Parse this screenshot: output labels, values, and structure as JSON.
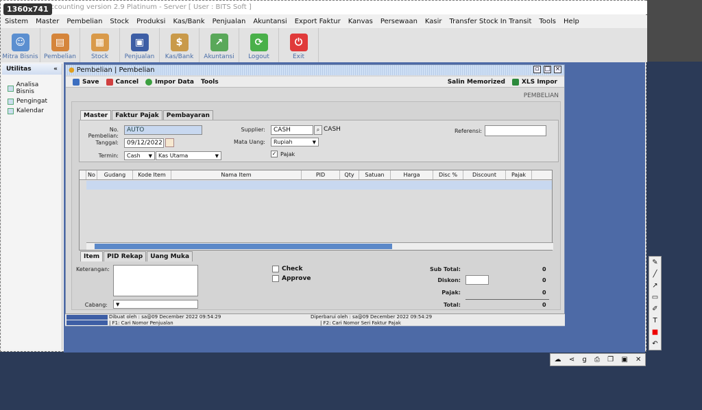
{
  "size_badge": "1360x741",
  "app_title": "Accounting version 2.9 Platinum - Server  [ User : BITS Soft ]",
  "menu": [
    "Sistem",
    "Master",
    "Pembelian",
    "Stock",
    "Produksi",
    "Kas/Bank",
    "Penjualan",
    "Akuntansi",
    "Export Faktur",
    "Kanvas",
    "Persewaan",
    "Kasir",
    "Transfer Stock In Transit",
    "Tools",
    "Help"
  ],
  "toolbar": [
    {
      "label": "Mitra Bisnis",
      "icon": "users-icon",
      "color": "#5b8fd0"
    },
    {
      "label": "Pembelian",
      "icon": "notebook-icon",
      "color": "#d5853b"
    },
    {
      "label": "Stock",
      "icon": "boxes-icon",
      "color": "#d99a4a"
    },
    {
      "label": "Penjualan",
      "icon": "shopping-bag-icon",
      "color": "#3d5ea5"
    },
    {
      "label": "Kas/Bank",
      "icon": "money-bag-icon",
      "color": "#c99a4a"
    },
    {
      "label": "Akuntansi",
      "icon": "chart-up-icon",
      "color": "#5aa85a"
    },
    {
      "label": "Logout",
      "icon": "logout-arrow-icon",
      "color": "#4ab04a"
    },
    {
      "label": "Exit",
      "icon": "power-icon",
      "color": "#e03a3a"
    }
  ],
  "sidebar": {
    "title": "Utilitas",
    "items": [
      "Analisa Bisnis",
      "Pengingat",
      "Kalendar"
    ]
  },
  "window": {
    "title": "Pembelian | Pembelian",
    "save": "Save",
    "cancel": "Cancel",
    "impor": "Impor Data",
    "tools": "Tools",
    "salin": "Salin Memorized",
    "xls": "XLS Impor",
    "section_label": "PEMBELIAN"
  },
  "form": {
    "tabs": [
      "Master",
      "Faktur Pajak",
      "Pembayaran"
    ],
    "no_label": "No. Pembelian:",
    "no_value": "AUTO",
    "tanggal_label": "Tanggal:",
    "tanggal_value": "09/12/2022",
    "termin_label": "Termin:",
    "termin_value": "Cash",
    "kas_value": "Kas Utama",
    "supplier_label": "Supplier:",
    "supplier_value": "CASH",
    "supplier_name": "CASH",
    "mata_uang_label": "Mata Uang:",
    "mata_uang_value": "Rupiah",
    "pajak_label": "Pajak",
    "referensi_label": "Referensi:"
  },
  "grid": {
    "columns": [
      "No",
      "Gudang",
      "Kode Item",
      "Nama Item",
      "PID",
      "Qty",
      "Satuan",
      "Harga",
      "Disc %",
      "Discount",
      "Pajak"
    ]
  },
  "bottom_tabs": [
    "Item",
    "PID Rekap",
    "Uang Muka"
  ],
  "bottom": {
    "keterangan_label": "Keterangan:",
    "cabang_label": "Cabang:",
    "check_label": "Check",
    "approve_label": "Approve",
    "subtotal_label": "Sub Total:",
    "subtotal_value": "0",
    "diskon_label": "Diskon:",
    "diskon_value": "0",
    "pajak_label": "Pajak:",
    "pajak_value": "0",
    "total_label": "Total:",
    "total_value": "0"
  },
  "status": {
    "created": "Dibuat oleh : sa@09 December 2022  09:54:29",
    "updated": "Diperbarui oleh : sa@09 December 2022  09:54:29",
    "f1": "| F1: Cari Nomor Penjualan",
    "f2": "| F2: Cari Nomor Seri Faktur Pajak"
  }
}
